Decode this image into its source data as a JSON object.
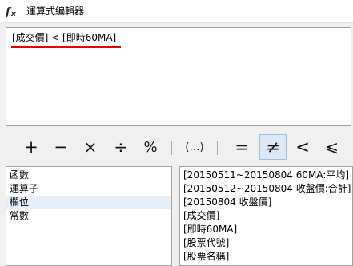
{
  "window": {
    "title": "運算式編輯器",
    "icon": "fx-icon"
  },
  "editor": {
    "expression": "[成交價] < [即時60MA]"
  },
  "operators": [
    {
      "label": "+",
      "name": "plus-button"
    },
    {
      "label": "−",
      "name": "minus-button"
    },
    {
      "label": "×",
      "name": "multiply-button"
    },
    {
      "label": "÷",
      "name": "divide-button"
    },
    {
      "label": "%",
      "name": "percent-button"
    },
    {
      "label": "(…)",
      "name": "parentheses-button"
    },
    {
      "label": "=",
      "name": "equals-button"
    },
    {
      "label": "≠",
      "name": "not-equal-button",
      "selected": true
    },
    {
      "label": "<",
      "name": "less-than-button"
    },
    {
      "label": "⩽",
      "name": "less-or-equal-button"
    }
  ],
  "categories": {
    "items": [
      "函數",
      "運算子",
      "欄位",
      "常數"
    ],
    "selected": "欄位"
  },
  "fields": {
    "items": [
      "[20150511~20150804 60MA:平均]",
      "[20150512~20150804 收盤價:合計]",
      "[20150804 收盤價]",
      "[成交價]",
      "[即時60MA]",
      "[股票代號]",
      "[股票名稱]"
    ]
  },
  "colors": {
    "underline": "#e00000",
    "selection": "#dce8f6"
  }
}
